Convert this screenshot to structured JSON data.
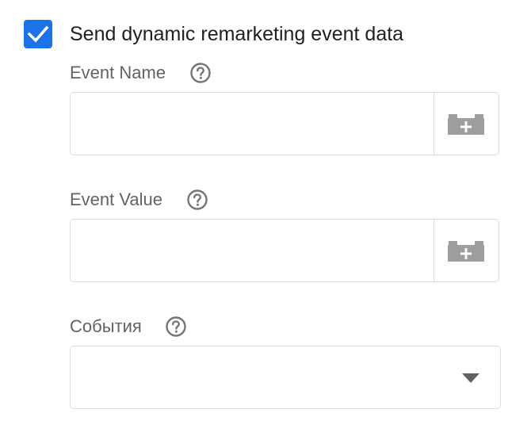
{
  "checkbox": {
    "checked": true,
    "label": "Send dynamic remarketing event data"
  },
  "fields": {
    "event_name": {
      "label": "Event Name",
      "value": "",
      "help_icon": "help-circle-icon",
      "variable_icon": "variable-brick-plus-icon"
    },
    "event_value": {
      "label": "Event Value",
      "value": "",
      "help_icon": "help-circle-icon",
      "variable_icon": "variable-brick-plus-icon"
    },
    "events": {
      "label": "События",
      "selected": "",
      "help_icon": "help-circle-icon",
      "dropdown_icon": "chevron-down-icon"
    }
  },
  "colors": {
    "accent": "#1a73e8",
    "label": "#5f6368",
    "text": "#202124",
    "border": "#dadce0",
    "icon": "#9e9e9e",
    "help_icon": "#757575"
  }
}
